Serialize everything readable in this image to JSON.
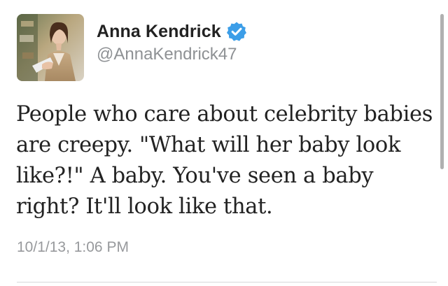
{
  "tweet": {
    "display_name": "Anna Kendrick",
    "handle": "@AnnaKendrick47",
    "text": "People who care about celebrity babies are creepy. \"What will her baby look like?!\" A baby. You've seen a baby right? It'll look like that.",
    "timestamp": "10/1/13, 1:06 PM",
    "verified": true
  },
  "icons": {
    "verified": "verified-badge-icon",
    "avatar": "profile-photo"
  },
  "colors": {
    "verified_badge": "#3c9ee8",
    "text": "#222222",
    "meta": "#8e9194"
  }
}
